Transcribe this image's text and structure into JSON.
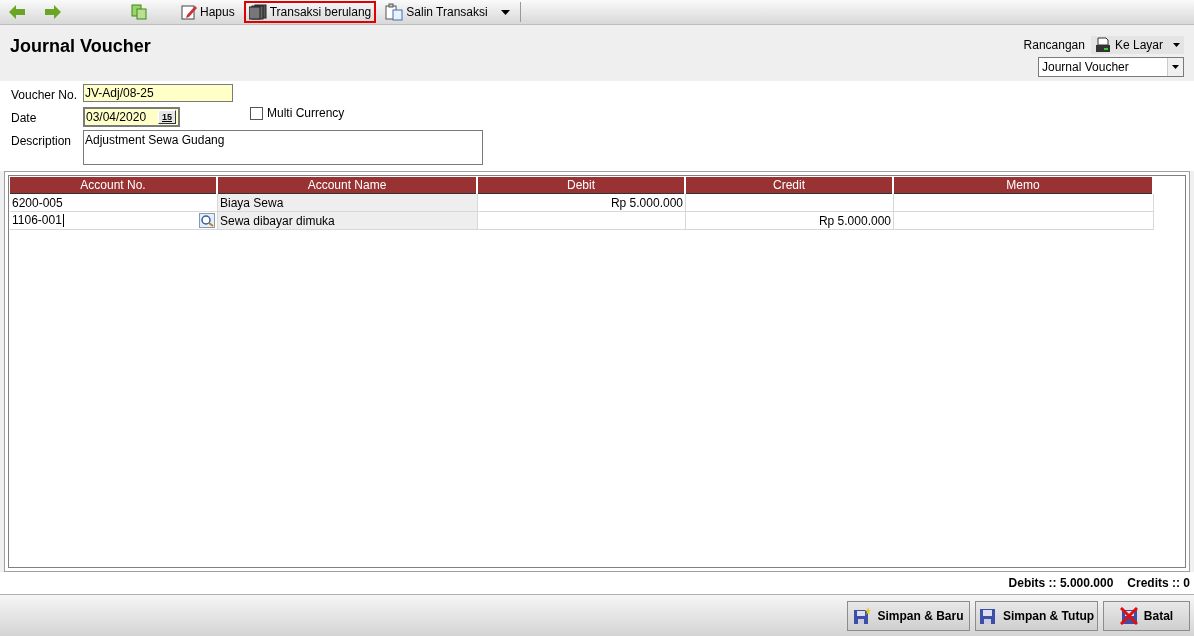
{
  "toolbar": {
    "items": [
      {
        "kind": "back",
        "highlighted": false
      },
      {
        "kind": "forward",
        "highlighted": false
      },
      {
        "kind": "copy",
        "highlighted": false
      },
      {
        "kind": "delete",
        "label": "Hapus",
        "highlighted": false
      },
      {
        "kind": "recurring",
        "label": "Transaksi berulang",
        "highlighted": true
      },
      {
        "kind": "duplicate",
        "label": "Salin Transaksi",
        "highlighted": false,
        "dropdown": true
      }
    ]
  },
  "title": "Journal Voucher",
  "design": {
    "label": "Rancangan",
    "output": "Ke Layar",
    "template": "Journal Voucher"
  },
  "form": {
    "voucher_no": {
      "label": "Voucher No.",
      "value": "JV-Adj/08-25"
    },
    "date": {
      "label": "Date",
      "value": "03/04/2020",
      "calendar_button": "15"
    },
    "multi_currency": {
      "label": "Multi Currency",
      "checked": false
    },
    "description": {
      "label": "Description",
      "value": "Adjustment Sewa Gudang"
    }
  },
  "table": {
    "columns": [
      "Account No.",
      "Account Name",
      "Debit",
      "Credit",
      "Memo"
    ],
    "rows": [
      {
        "cells": [
          "6200-005",
          "Biaya Sewa",
          "Rp 5.000.000",
          "",
          ""
        ],
        "editing": false
      },
      {
        "cells": [
          "1106-001",
          "Sewa dibayar dimuka",
          "",
          "Rp 5.000.000",
          ""
        ],
        "editing": true
      }
    ]
  },
  "totals": [
    {
      "label": "Debits ::",
      "value": "5.000.000"
    },
    {
      "label": "Credits ::",
      "value": "0"
    }
  ],
  "buttons": [
    {
      "kind": "save_new",
      "label": "Simpan & Baru"
    },
    {
      "kind": "save_close",
      "label": "Simpan & Tutup"
    },
    {
      "kind": "cancel",
      "label": "Batal"
    }
  ]
}
